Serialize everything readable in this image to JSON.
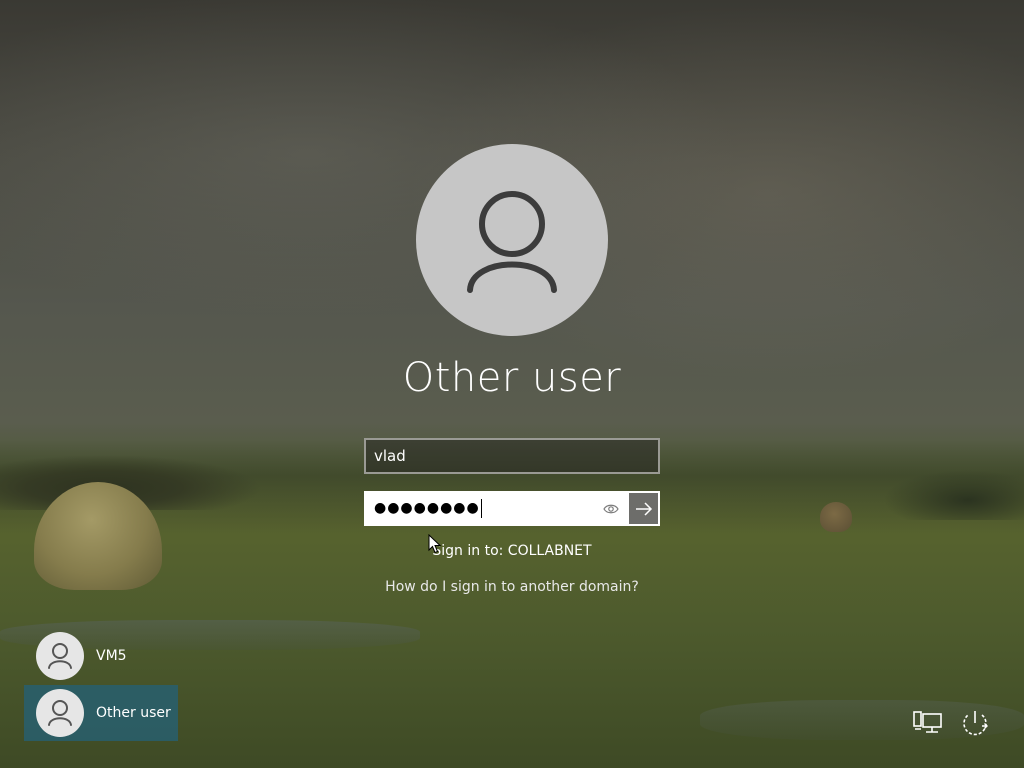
{
  "screen": {
    "kind": "Windows sign-in screen"
  },
  "account": {
    "display_name": "Other user",
    "username_value": "vlad",
    "password_masked": "●●●●●●●●",
    "signin_target": "Sign in to: COLLABNET",
    "domain_help_link": "How do I sign in to another domain?"
  },
  "user_list": [
    {
      "label": "VM5",
      "selected": false
    },
    {
      "label": "Other user",
      "selected": true
    }
  ],
  "colors": {
    "selected_tile": "#285f6e",
    "avatar_bg": "#c6c6c6",
    "submit_bg": "#6d6d6a"
  },
  "icons": {
    "avatar": "person-icon",
    "reveal": "eye-icon",
    "submit": "arrow-right-icon",
    "network": "network-icon",
    "power": "power-icon"
  }
}
